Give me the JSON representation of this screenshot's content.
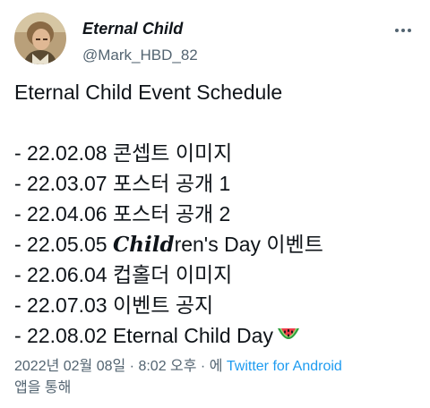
{
  "author": {
    "display_name": "Eternal Child",
    "handle": "@Mark_HBD_82",
    "avatar_icon": "profile-photo"
  },
  "tweet": {
    "title_line": "Eternal Child Event Schedule",
    "items": [
      {
        "text": "- 22.02.08 콘셉트 이미지"
      },
      {
        "text": "- 22.03.07 포스터 공개 1"
      },
      {
        "text": "- 22.04.06 포스터 공개 2"
      },
      {
        "prefix": "- 22.05.05 ",
        "fancy": "Child",
        "suffix": "ren's Day 이벤트"
      },
      {
        "text": "- 22.06.04 컵홀더 이미지"
      },
      {
        "text": "- 22.07.03 이벤트 공지"
      },
      {
        "text": "- 22.08.02 Eternal Child Day",
        "emoji": "watermelon"
      }
    ]
  },
  "meta": {
    "timestamp": "2022년 02월 08일 · 8:02 오후 · 에 ",
    "source": "Twitter for Android",
    "suffix": "앱을 통해"
  },
  "colors": {
    "text": "#0f1419",
    "secondary": "#536471",
    "link": "#1d9bf0"
  },
  "icons": {
    "more": "more-dots-icon",
    "emoji": "watermelon-icon"
  }
}
